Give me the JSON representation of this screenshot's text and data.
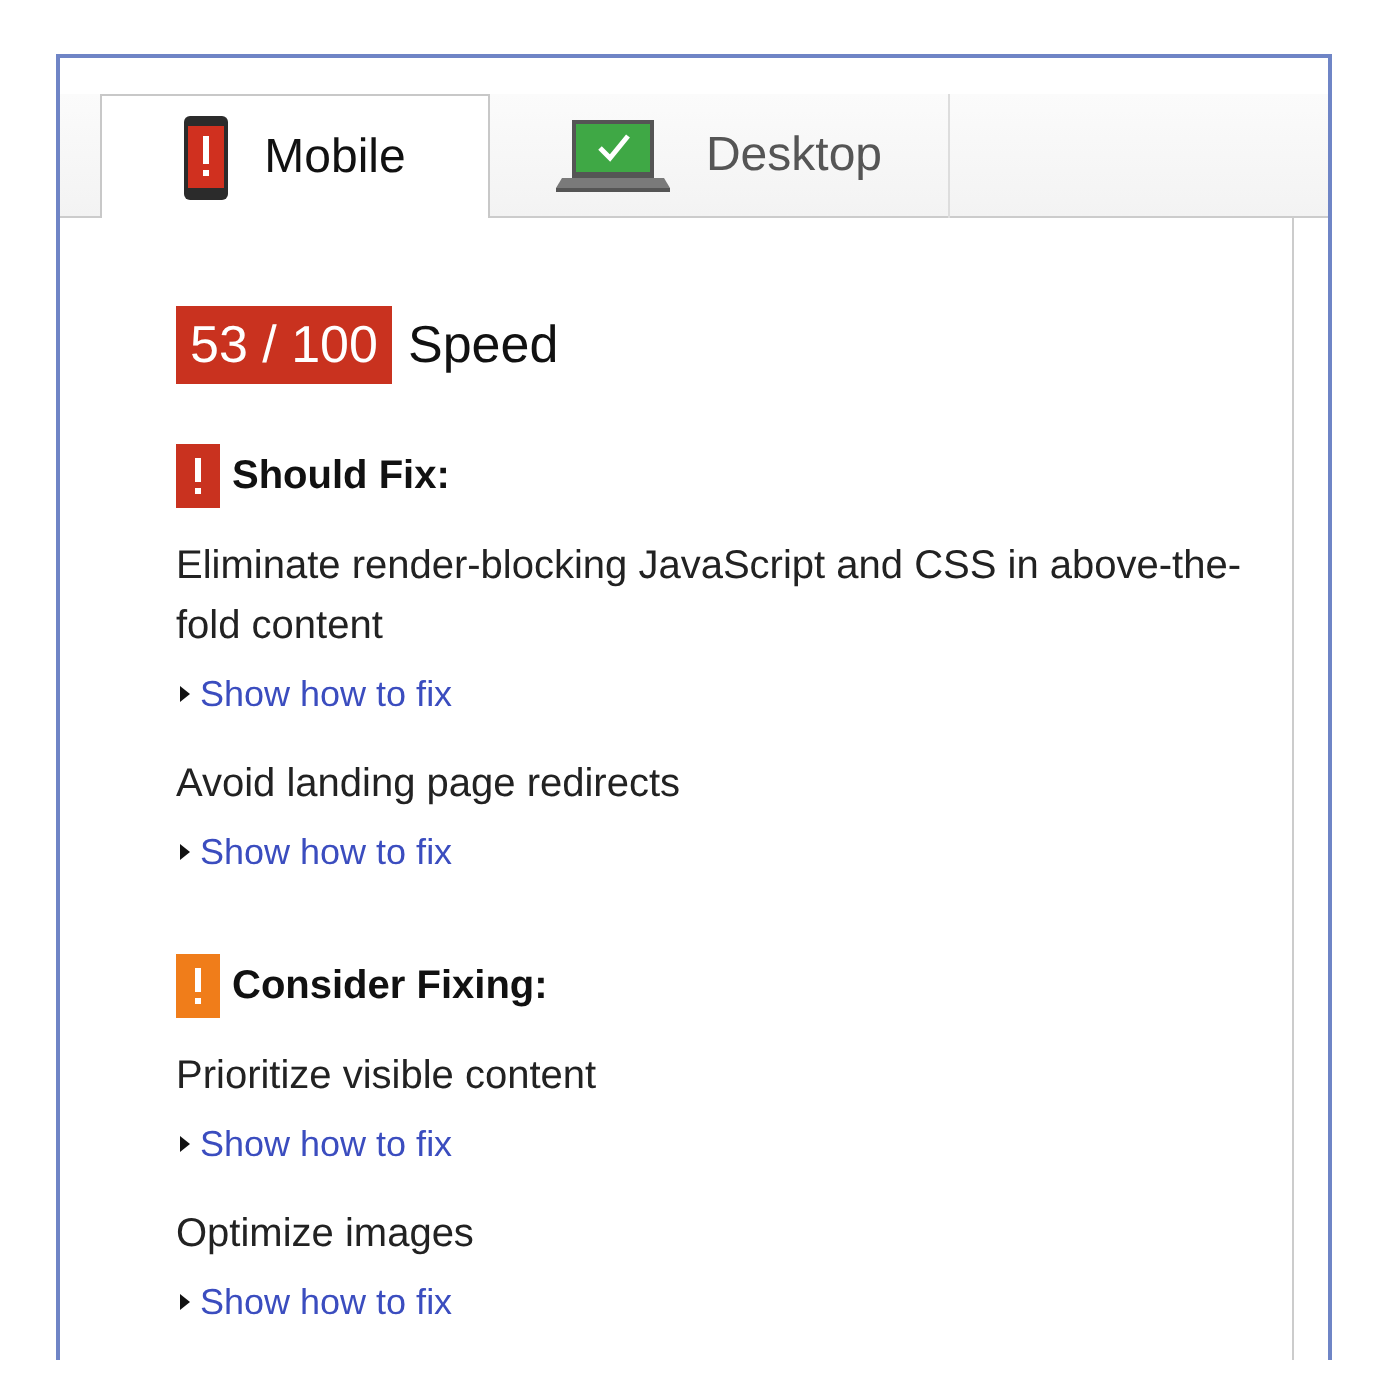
{
  "tabs": [
    {
      "kind": "mobile",
      "label": "Mobile",
      "selected": true
    },
    {
      "kind": "desktop",
      "label": "Desktop",
      "selected": false
    }
  ],
  "score": {
    "value": "53 / 100",
    "label": "Speed"
  },
  "sections": [
    {
      "heading": "Should Fix:",
      "color": "#c9321f",
      "rules": [
        {
          "title": "Eliminate render-blocking JavaScript and CSS in above-the-fold content",
          "link": "Show how to fix"
        },
        {
          "title": "Avoid landing page redirects",
          "link": "Show how to fix"
        }
      ]
    },
    {
      "heading": "Consider Fixing:",
      "color": "#f07d1a",
      "rules": [
        {
          "title": "Prioritize visible content",
          "link": "Show how to fix"
        },
        {
          "title": "Optimize images",
          "link": "Show how to fix"
        }
      ]
    }
  ]
}
